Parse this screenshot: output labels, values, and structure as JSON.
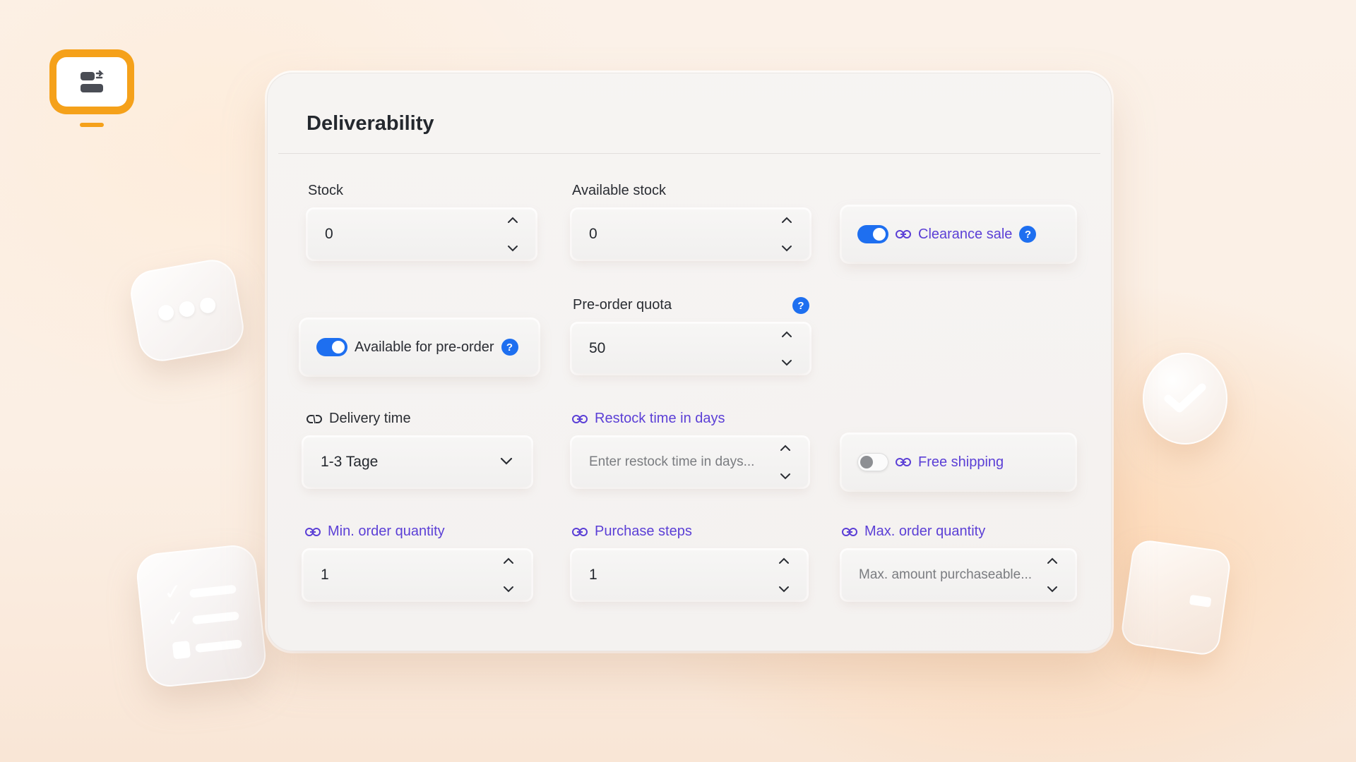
{
  "colors": {
    "accent": "#1e6ff0",
    "link": "#5b3fd6",
    "logo": "#f5a11a",
    "text": "#24282e"
  },
  "card": {
    "title": "Deliverability"
  },
  "stock": {
    "label": "Stock",
    "value": "0"
  },
  "available_stock": {
    "label": "Available stock",
    "value": "0"
  },
  "clearance_sale": {
    "label": "Clearance sale",
    "enabled": true,
    "help": "?"
  },
  "preorder": {
    "label": "Available for pre-order",
    "enabled": true,
    "help": "?"
  },
  "preorder_quota": {
    "label": "Pre-order quota",
    "value": "50",
    "help": "?"
  },
  "delivery_time": {
    "label": "Delivery time",
    "value": "1-3 Tage"
  },
  "restock_time": {
    "label": "Restock time in days",
    "placeholder": "Enter restock time in days..."
  },
  "free_shipping": {
    "label": "Free shipping",
    "enabled": false
  },
  "min_order": {
    "label": "Min. order quantity",
    "value": "1"
  },
  "purchase_steps": {
    "label": "Purchase steps",
    "value": "1"
  },
  "max_order": {
    "label": "Max. order quantity",
    "placeholder": "Max. amount purchaseable..."
  },
  "icons": {
    "link": "link-icon",
    "unlink": "unlink-icon",
    "stepper_up": "chevron-up-icon",
    "stepper_down": "chevron-down-icon",
    "dropdown": "chevron-down-icon",
    "help": "help-icon"
  }
}
